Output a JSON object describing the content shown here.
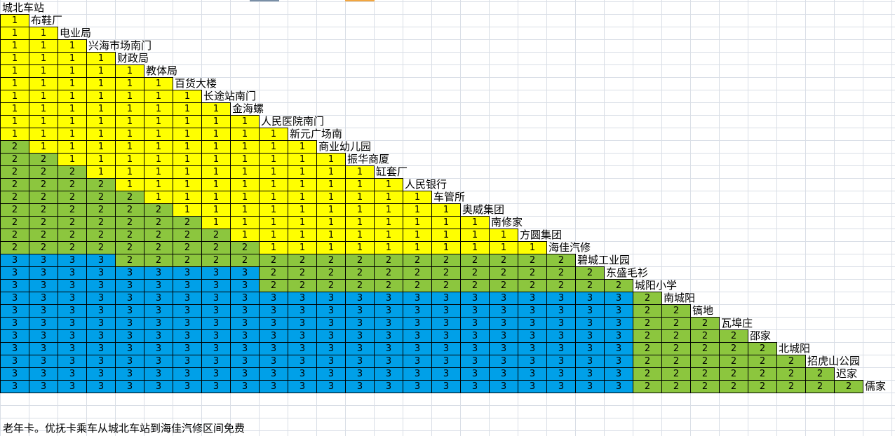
{
  "colors": {
    "1": "#ffff00",
    "2": "#8cc63e",
    "3": "#00a0e8"
  },
  "stops": [
    "城北车站",
    "布鞋厂",
    "电业局",
    "兴海市场南门",
    "财政局",
    "教体局",
    "百货大楼",
    "长途站南门",
    "金海螺",
    "人民医院南门",
    "新元广场南",
    "商业幼儿园",
    "振华商厦",
    "缸套厂",
    "人民银行",
    "车管所",
    "奥威集团",
    "南修家",
    "方圆集团",
    "海佳汽修",
    "碧城工业园",
    "东盛毛衫",
    "城阳小学",
    "南城阳",
    "镐地",
    "瓦埠庄",
    "邵家",
    "北城阳",
    "招虎山公园",
    "迟家",
    "儒家"
  ],
  "fares": [
    "1",
    "11",
    "111",
    "1111",
    "11111",
    "111111",
    "1111111",
    "11111111",
    "111111111",
    "1111111111",
    "21111111111",
    "221111111111",
    "2221111111111",
    "22221111111111",
    "222221111111111",
    "2222221111111111",
    "22222221111111111",
    "222222221111111111",
    "2222222221111111111",
    "33332222222222222222",
    "333333333222222222222",
    "3333333332222222222222",
    "33333333333333333333332",
    "333333333333333333333322",
    "3333333333333333333333222",
    "33333333333333333333332222",
    "333333333333333333333322222",
    "3333333333333333333333222222",
    "33333333333333333333332222222",
    "333333333333333333333322222222"
  ],
  "note": "老年卡。优抚卡乘车从城北车站到海佳汽修区间免费"
}
